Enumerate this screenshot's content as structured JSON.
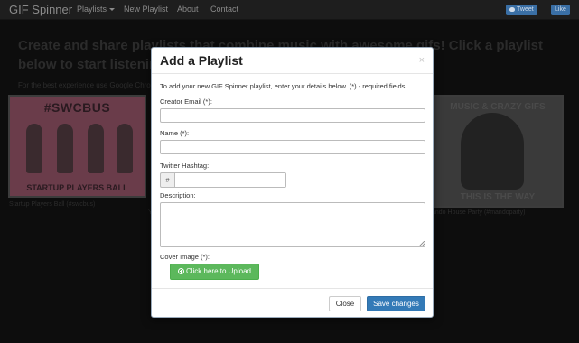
{
  "navbar": {
    "brand": "GIF Spinner",
    "links": {
      "playlists": "Playlists",
      "new_playlist": "New Playlist",
      "about": "About",
      "contact": "Contact"
    },
    "tweet_label": "Tweet",
    "like_label": "Like"
  },
  "hero": {
    "heading": "Create and share playlists that combine music with awesome gifs! Click a playlist below to start listening.",
    "hint": "For the best experience use Google Chrome"
  },
  "thumbnails": {
    "left": {
      "hashtag": "#SWCBUS",
      "caption": "STARTUP PLAYERS BALL",
      "title": "Startup Players Ball (#swcbus)"
    },
    "middle": {
      "title": "Y"
    },
    "right": {
      "top_text": "MUSIC & CRAZY GIFS",
      "bottom_text": "THIS IS THE WAY",
      "title": "ando House Party (#mandoparty)"
    }
  },
  "modal": {
    "title": "Add a Playlist",
    "close_symbol": "×",
    "intro": "To add your new GIF Spinner playlist, enter your details below. (*) - required fields",
    "fields": {
      "email": {
        "label": "Creator Email (*):",
        "value": ""
      },
      "name": {
        "label": "Name (*):",
        "value": ""
      },
      "hashtag": {
        "label": "Twitter Hashtag:",
        "prefix": "#",
        "value": ""
      },
      "description": {
        "label": "Description:",
        "value": ""
      },
      "cover": {
        "label": "Cover Image (*):",
        "button": "Click here to Upload"
      }
    },
    "footer": {
      "close": "Close",
      "save": "Save changes"
    }
  },
  "colors": {
    "primary": "#337ab7",
    "success": "#5cb85c",
    "backdrop": "#0d0d0d"
  }
}
